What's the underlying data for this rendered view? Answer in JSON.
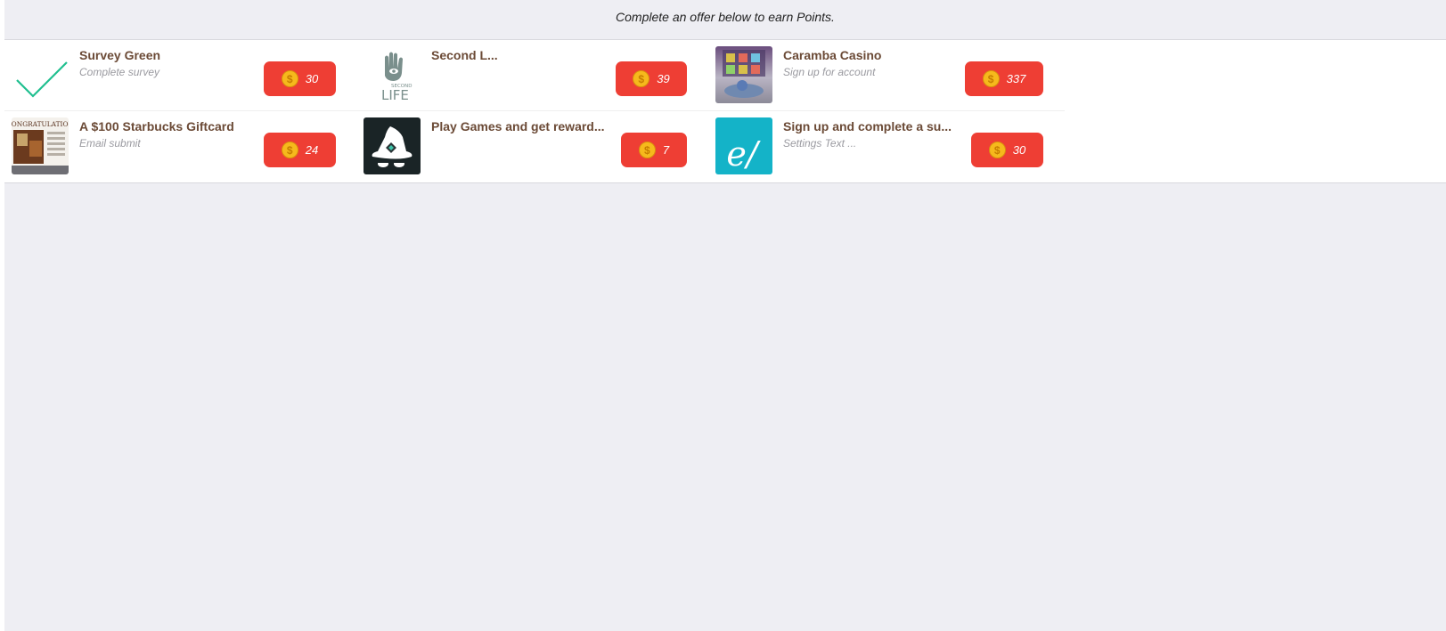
{
  "header": {
    "message": "Complete an offer below to earn Points."
  },
  "offers": [
    {
      "title": "Survey Green",
      "subtitle": "Complete survey",
      "points": "30",
      "icon": "checkmark-icon"
    },
    {
      "title": "Second L...",
      "subtitle": "",
      "points": "39",
      "icon": "second-life-logo"
    },
    {
      "title": "Caramba Casino",
      "subtitle": "Sign up for account",
      "points": "337",
      "icon": "casino-thumbnail"
    },
    {
      "title": "A $100 Starbucks Giftcard",
      "subtitle": "Email submit",
      "points": "24",
      "icon": "starbucks-congratulations-thumbnail",
      "thumb_text": "CONGRATULATION"
    },
    {
      "title": "Play Games and get reward...",
      "subtitle": "",
      "points": "7",
      "icon": "wizard-hat-icon"
    },
    {
      "title": "Sign up and complete a su...",
      "subtitle": "Settings Text ...",
      "points": "30",
      "icon": "e-logo-icon",
      "thumb_text": "e/"
    }
  ],
  "coin_symbol": "$",
  "colors": {
    "button": "#ee3e34",
    "coin": "#f6b91c",
    "title": "#6b4a36",
    "background": "#eeeef3",
    "check": "#1fbf8f"
  }
}
